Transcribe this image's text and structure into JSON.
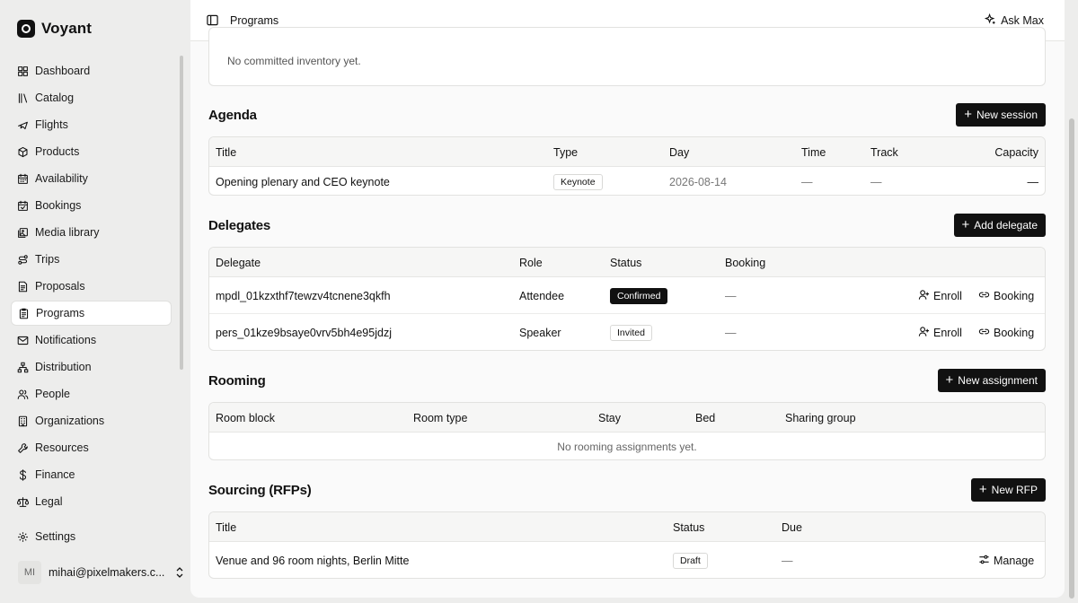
{
  "app": {
    "name": "Voyant"
  },
  "sidebar": {
    "items": [
      {
        "label": "Dashboard",
        "icon": "dashboard-icon"
      },
      {
        "label": "Catalog",
        "icon": "library-icon"
      },
      {
        "label": "Flights",
        "icon": "plane-icon"
      },
      {
        "label": "Products",
        "icon": "package-icon"
      },
      {
        "label": "Availability",
        "icon": "calendar-icon"
      },
      {
        "label": "Bookings",
        "icon": "calendar-check-icon"
      },
      {
        "label": "Media library",
        "icon": "images-icon"
      },
      {
        "label": "Trips",
        "icon": "route-icon"
      },
      {
        "label": "Proposals",
        "icon": "file-text-icon"
      },
      {
        "label": "Programs",
        "icon": "clipboard-icon",
        "active": true
      },
      {
        "label": "Notifications",
        "icon": "mail-icon"
      },
      {
        "label": "Distribution",
        "icon": "network-icon"
      },
      {
        "label": "People",
        "icon": "users-icon"
      },
      {
        "label": "Organizations",
        "icon": "building-icon"
      },
      {
        "label": "Resources",
        "icon": "wrench-icon"
      },
      {
        "label": "Finance",
        "icon": "dollar-icon"
      },
      {
        "label": "Legal",
        "icon": "scale-icon"
      }
    ],
    "settings": "Settings",
    "user": {
      "initials": "MI",
      "email": "mihai@pixelmakers.c..."
    }
  },
  "topbar": {
    "breadcrumb": "Programs",
    "ask": "Ask Max"
  },
  "inventory": {
    "empty": "No committed inventory yet."
  },
  "agenda": {
    "title": "Agenda",
    "button": "New session",
    "columns": [
      "Title",
      "Type",
      "Day",
      "Time",
      "Track",
      "Capacity"
    ],
    "rows": [
      {
        "title": "Opening plenary and CEO keynote",
        "type": "Keynote",
        "day": "2026-08-14",
        "time": "—",
        "track": "—",
        "capacity": "—"
      }
    ]
  },
  "delegates": {
    "title": "Delegates",
    "button": "Add delegate",
    "columns": [
      "Delegate",
      "Role",
      "Status",
      "Booking"
    ],
    "rows": [
      {
        "delegate": "mpdl_01kzxthf7tewzv4tcnene3qkfh",
        "role": "Attendee",
        "status": "Confirmed",
        "status_style": "dark",
        "booking": "—",
        "enroll": "Enroll",
        "booking_action": "Booking"
      },
      {
        "delegate": "pers_01kze9bsaye0vrv5bh4e95jdzj",
        "role": "Speaker",
        "status": "Invited",
        "status_style": "light",
        "booking": "—",
        "enroll": "Enroll",
        "booking_action": "Booking"
      }
    ]
  },
  "rooming": {
    "title": "Rooming",
    "button": "New assignment",
    "columns": [
      "Room block",
      "Room type",
      "Stay",
      "Bed",
      "Sharing group"
    ],
    "empty": "No rooming assignments yet."
  },
  "sourcing": {
    "title": "Sourcing (RFPs)",
    "button": "New RFP",
    "columns": [
      "Title",
      "Status",
      "Due"
    ],
    "rows": [
      {
        "title": "Venue and 96 room nights, Berlin Mitte",
        "status": "Draft",
        "due": "—",
        "action": "Manage"
      }
    ]
  }
}
